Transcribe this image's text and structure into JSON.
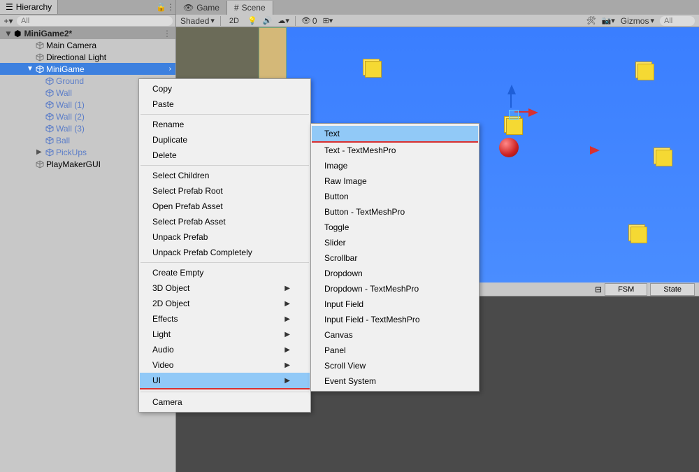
{
  "hierarchy": {
    "tab_label": "Hierarchy",
    "search_placeholder": "All",
    "plus": "+",
    "scene": "MiniGame2*",
    "items": [
      {
        "label": "Main Camera",
        "indent": 1,
        "expand": "",
        "prefab": false
      },
      {
        "label": "Directional Light",
        "indent": 1,
        "expand": "",
        "prefab": false
      },
      {
        "label": "MiniGame",
        "indent": 1,
        "expand": "▼",
        "prefab": true,
        "selected": true
      },
      {
        "label": "Ground",
        "indent": 2,
        "expand": "",
        "prefab": true
      },
      {
        "label": "Wall",
        "indent": 2,
        "expand": "",
        "prefab": true
      },
      {
        "label": "Wall (1)",
        "indent": 2,
        "expand": "",
        "prefab": true
      },
      {
        "label": "Wall (2)",
        "indent": 2,
        "expand": "",
        "prefab": true
      },
      {
        "label": "Wall (3)",
        "indent": 2,
        "expand": "",
        "prefab": true
      },
      {
        "label": "Ball",
        "indent": 2,
        "expand": "",
        "prefab": true
      },
      {
        "label": "PickUps",
        "indent": 2,
        "expand": "▶",
        "prefab": true
      },
      {
        "label": "PlayMakerGUI",
        "indent": 1,
        "expand": "",
        "prefab": false
      }
    ]
  },
  "scene_tabs": {
    "game": "Game",
    "scene": "Scene"
  },
  "toolbar": {
    "shaded": "Shaded",
    "mode_2d": "2D",
    "vis_count": "0",
    "gizmos": "Gizmos",
    "search_placeholder": "All"
  },
  "preview": {
    "fsm": "FSM",
    "state": "State"
  },
  "context_menu": {
    "items1": [
      "Copy",
      "Paste"
    ],
    "items2": [
      "Rename",
      "Duplicate",
      "Delete"
    ],
    "items3": [
      "Select Children",
      "Select Prefab Root",
      "Open Prefab Asset",
      "Select Prefab Asset",
      "Unpack Prefab",
      "Unpack Prefab Completely"
    ],
    "items4": [
      "Create Empty"
    ],
    "items4sub": [
      "3D Object",
      "2D Object",
      "Effects",
      "Light",
      "Audio",
      "Video",
      "UI"
    ],
    "items5": [
      "Camera"
    ]
  },
  "submenu": {
    "items": [
      "Text",
      "Text - TextMeshPro",
      "Image",
      "Raw Image",
      "Button",
      "Button - TextMeshPro",
      "Toggle",
      "Slider",
      "Scrollbar",
      "Dropdown",
      "Dropdown - TextMeshPro",
      "Input Field",
      "Input Field - TextMeshPro",
      "Canvas",
      "Panel",
      "Scroll View",
      "Event System"
    ]
  }
}
